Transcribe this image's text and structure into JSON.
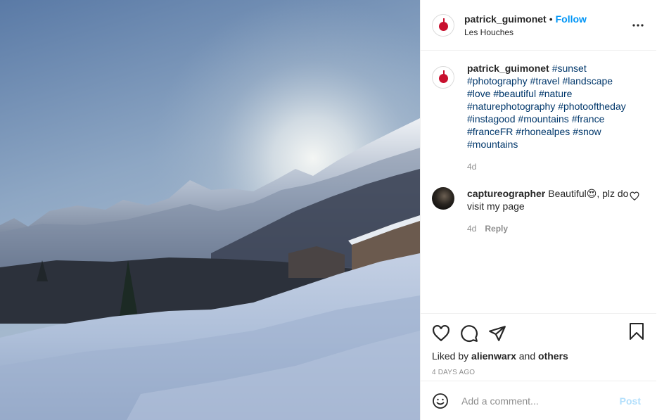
{
  "post": {
    "username": "patrick_guimonet",
    "separator": "•",
    "follow_label": "Follow",
    "location": "Les Houches",
    "caption": {
      "username": "patrick_guimonet",
      "hashtags": [
        "#sunset",
        "#photography",
        "#travel",
        "#landscape",
        "#love",
        "#beautiful",
        "#nature",
        "#naturephotography",
        "#photooftheday",
        "#instagood",
        "#mountains",
        "#france",
        "#franceFR",
        "#rhonealpes",
        "#snow",
        "#mountains"
      ],
      "time": "4d"
    },
    "comments": [
      {
        "username": "captureographer",
        "text": "Beautiful😍, plz do visit my page",
        "time": "4d",
        "reply_label": "Reply"
      }
    ],
    "likes": {
      "prefix": "Liked by",
      "user": "alienwarx",
      "conjunction": "and",
      "others": "others"
    },
    "timestamp": "4 DAYS AGO",
    "add_comment": {
      "placeholder": "Add a comment...",
      "post_label": "Post"
    }
  },
  "icons": {
    "more": "more-horizontal-icon",
    "like": "heart-icon",
    "comment": "comment-bubble-icon",
    "share": "paper-plane-icon",
    "save": "bookmark-icon",
    "emoji": "smiley-icon"
  },
  "colors": {
    "follow": "#0095f6",
    "hashtag": "#00376b",
    "muted": "#8e8e8e",
    "post_disabled": "#b2dffc"
  }
}
